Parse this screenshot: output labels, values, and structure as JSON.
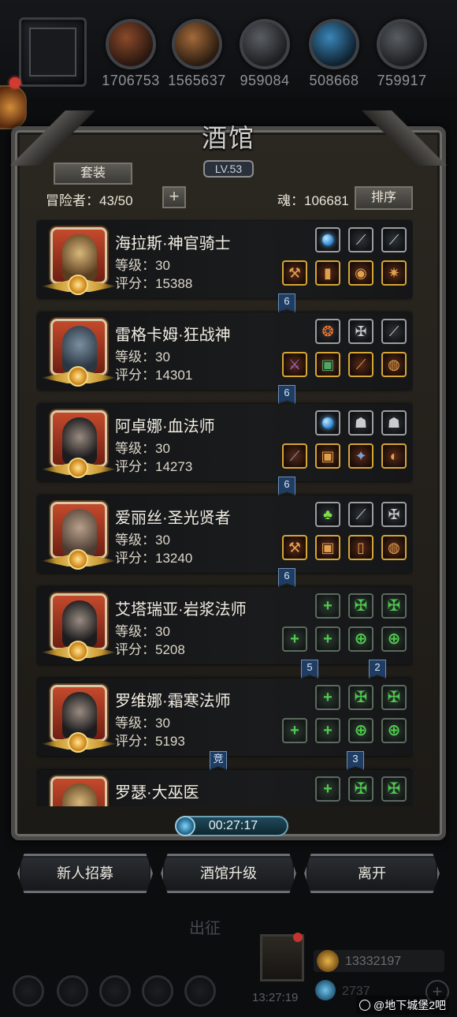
{
  "resources": [
    {
      "icon": "copper-ore-icon",
      "value": "1706753"
    },
    {
      "icon": "wood-plank-icon",
      "value": "1565637"
    },
    {
      "icon": "stone-icon",
      "value": "959084"
    },
    {
      "icon": "crystal-icon",
      "value": "508668"
    },
    {
      "icon": "iron-icon",
      "value": "759917"
    }
  ],
  "tavern": {
    "title": "酒馆",
    "level": "LV.53",
    "suit_label": "套装",
    "adventurers_label": "冒险者：43/50",
    "plus_label": "+",
    "soul_label": "魂：106681",
    "sort_label": "排序"
  },
  "heroes": [
    {
      "name": "海拉斯·神官骑士",
      "level": "等级：30",
      "score": "评分：15388"
    },
    {
      "name": "雷格卡姆·狂战神",
      "level": "等级：30",
      "score": "评分：14301"
    },
    {
      "name": "阿卓娜·血法师",
      "level": "等级：30",
      "score": "评分：14273"
    },
    {
      "name": "爱丽丝·圣光贤者",
      "level": "等级：30",
      "score": "评分：13240"
    },
    {
      "name": "艾塔瑞亚·岩浆法师",
      "level": "等级：30",
      "score": "评分：5208"
    },
    {
      "name": "罗维娜·霜寒法师",
      "level": "等级：30",
      "score": "评分：5193"
    },
    {
      "name": "罗瑟·大巫医",
      "level": "",
      "score": ""
    }
  ],
  "links": [
    "6",
    "6",
    "6",
    "6",
    "5",
    "2",
    "竞",
    "3"
  ],
  "timer": "00:27:17",
  "buttons": {
    "recruit": "新人招募",
    "upgrade": "酒馆升级",
    "leave": "离开"
  },
  "bottom": {
    "expedition": "出征",
    "clock": "13:27:19",
    "gold": "13332197",
    "gems": "2737",
    "watermark": "@地下城堡2吧"
  }
}
